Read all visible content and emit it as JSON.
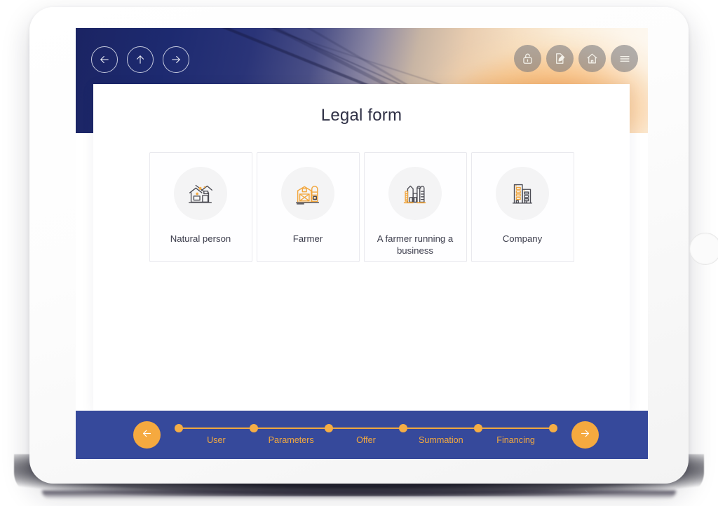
{
  "banner": {
    "nav_buttons": [
      {
        "name": "back-arrow-icon",
        "label": "Back"
      },
      {
        "name": "up-arrow-icon",
        "label": "Up"
      },
      {
        "name": "forward-arrow-icon",
        "label": "Forward"
      }
    ],
    "tool_buttons": [
      {
        "name": "lock-icon",
        "label": "Lock"
      },
      {
        "name": "edit-icon",
        "label": "Edit"
      },
      {
        "name": "home-icon",
        "label": "Home"
      },
      {
        "name": "menu-icon",
        "label": "Menu"
      }
    ]
  },
  "main": {
    "title": "Legal form",
    "options": [
      {
        "label": "Natural person",
        "icon": "house-icon"
      },
      {
        "label": "Farmer",
        "icon": "barn-icon"
      },
      {
        "label": "A farmer running a business",
        "icon": "factory-icon"
      },
      {
        "label": "Company",
        "icon": "office-buildings-icon"
      }
    ]
  },
  "footer": {
    "prev_label": "Previous",
    "next_label": "Next",
    "steps": [
      {
        "label": "User"
      },
      {
        "label": "Parameters"
      },
      {
        "label": "Offer"
      },
      {
        "label": "Summation"
      },
      {
        "label": "Financing"
      }
    ]
  },
  "colors": {
    "footer_blue": "#36499b",
    "accent_orange": "#f5a93f",
    "banner_navy": "#1b2463",
    "title_text": "#2f3045"
  }
}
